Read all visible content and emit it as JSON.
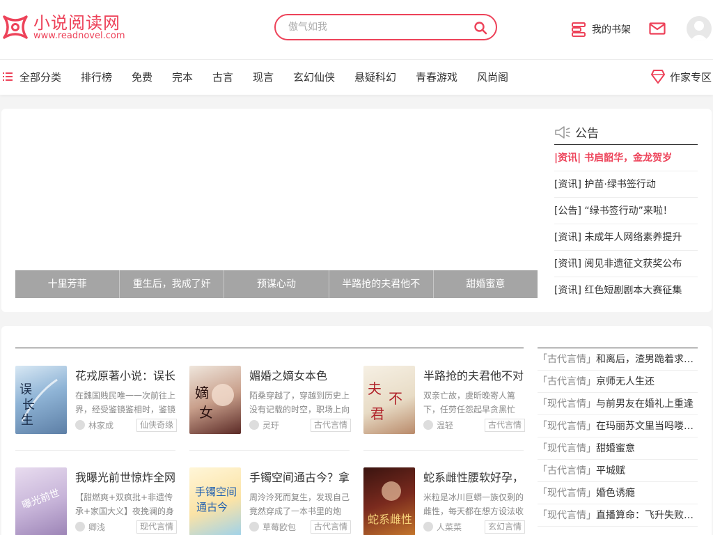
{
  "header": {
    "logo_cn": "小说阅读网",
    "logo_en": "www.readnovel.com",
    "search_placeholder": "傲气如我",
    "shelf_label": "我的书架"
  },
  "nav": {
    "items": [
      "全部分类",
      "排行榜",
      "免费",
      "完本",
      "古言",
      "现言",
      "玄幻仙侠",
      "悬疑科幻",
      "青春游戏",
      "风尚阁"
    ],
    "writer": "作家专区"
  },
  "slider": {
    "tabs": [
      "十里芳菲",
      "重生后，我成了奸",
      "预谋心动",
      "半路抢的夫君他不",
      "甜婚蜜意"
    ]
  },
  "notice": {
    "title": "公告",
    "items": [
      "|资讯| 书启韶华，金龙贺岁",
      "[资讯] 护苗·绿书签行动",
      "[公告] “绿书签行动”来啦！",
      "[资讯] 未成年人网络素养提升",
      "[资讯] 阅见非遗征文获奖公布",
      "[资讯] 红色短剧剧本大赛征集"
    ]
  },
  "books": [
    {
      "title": "花戎原著小说：误长",
      "desc": "在魏国贱民唯一一次前往上界，经受鉴镜鉴相时，鉴镜",
      "author": "林家成",
      "tag": "仙侠奇缘",
      "cover_text": "误长生"
    },
    {
      "title": "媚婚之嫡女本色",
      "desc": "陌桑穿越了，穿越到历史上没有记载的时空，职场上向",
      "author": "灵玗",
      "tag": "古代言情",
      "cover_text": "嫡女本色"
    },
    {
      "title": "半路抢的夫君他不对",
      "desc": "双亲亡故，虞昕晚寄人篱下，任劳任怨起早贪黑忙",
      "author": "温轻",
      "tag": "古代言情",
      "cover_text": "夫君不对劲"
    },
    {
      "title": "我曝光前世惊炸全网",
      "desc": "【甜燃爽+双疯批+非遗传承+家国大义】夜挽澜的身",
      "author": "卿浅",
      "tag": "现代言情",
      "cover_text": "曝光前世"
    },
    {
      "title": "手镯空间通古今？拿",
      "desc": "周泠泠死而复生，发现自己竟然穿成了一本书里的炮",
      "author": "草莓欧包",
      "tag": "古代言情",
      "cover_text": "手镯空间通古今"
    },
    {
      "title": "蛇系雌性腰软好孕，",
      "desc": "米粒是冰川巨蟒一族仅剩的雌性，每天都在想方设法收",
      "author": "人菜菜",
      "tag": "玄幻言情",
      "cover_text": "蛇系雌性"
    }
  ],
  "rank": [
    {
      "cat": "「古代言情」",
      "name": "和离后，渣男跪着求我…"
    },
    {
      "cat": "「古代言情」",
      "name": "京师无人生还"
    },
    {
      "cat": "「现代言情」",
      "name": "与前男友在婚礼上重逢"
    },
    {
      "cat": "「现代言情」",
      "name": "在玛丽苏文里当吗喽的…"
    },
    {
      "cat": "「现代言情」",
      "name": "甜婚蜜意"
    },
    {
      "cat": "「古代言情」",
      "name": "平城赋"
    },
    {
      "cat": "「现代言情」",
      "name": "婚色诱瘾"
    },
    {
      "cat": "「现代言情」",
      "name": "直播算命：飞升失败后…"
    }
  ],
  "colors": {
    "accent": "#ed4259",
    "tab_bg": "#a5a5a5"
  }
}
